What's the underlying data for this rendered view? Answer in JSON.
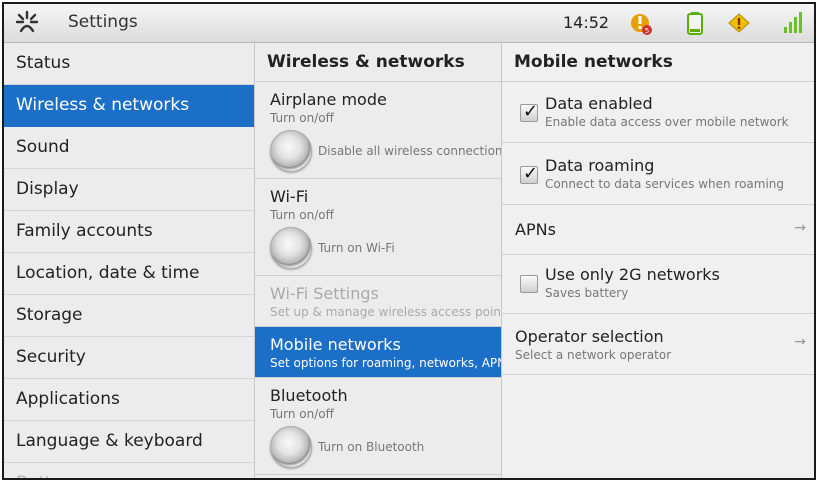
{
  "status_bar": {
    "app_title": "Settings",
    "time": "14:52",
    "icons": [
      "settings-app-icon",
      "alert-icon",
      "battery-icon",
      "warning-icon",
      "signal-icon"
    ],
    "colors": {
      "alert": "#e8a000",
      "battery": "#59b000",
      "warning": "#f0c000",
      "signal": "#6abf2a"
    }
  },
  "categories": [
    "Status",
    "Wireless & networks",
    "Sound",
    "Display",
    "Family accounts",
    "Location, date & time",
    "Storage",
    "Security",
    "Applications",
    "Language & keyboard",
    "Battery use"
  ],
  "selected_category": "Wireless & networks",
  "wireless": {
    "header": "Wireless & networks",
    "airplane": {
      "title": "Airplane mode",
      "summary": "Turn on/off",
      "toggle_label": "Disable all wireless connections"
    },
    "wifi": {
      "title": "Wi-Fi",
      "summary": "Turn on/off",
      "toggle_label": "Turn on Wi-Fi"
    },
    "wifi_settings": {
      "title": "Wi-Fi Settings",
      "summary": "Set up & manage wireless access points"
    },
    "mobile": {
      "title": "Mobile networks",
      "summary": "Set options for roaming, networks, APNs"
    },
    "bluetooth": {
      "title": "Bluetooth",
      "summary": "Turn on/off",
      "toggle_label": "Turn on Bluetooth"
    }
  },
  "mobile_networks": {
    "header": "Mobile networks",
    "data_enabled": {
      "title": "Data enabled",
      "summary": "Enable data access over mobile network",
      "checked": true
    },
    "data_roaming": {
      "title": "Data roaming",
      "summary": "Connect to data services when roaming",
      "checked": true
    },
    "apns": {
      "title": "APNs"
    },
    "use_2g": {
      "title": "Use only 2G networks",
      "summary": "Saves battery",
      "checked": false
    },
    "operator": {
      "title": "Operator selection",
      "summary": "Select a network operator"
    },
    "check_mark": "✓",
    "arrow": "→"
  }
}
